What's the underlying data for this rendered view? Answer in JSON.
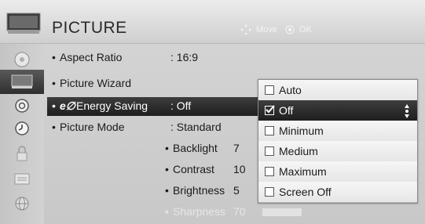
{
  "header": {
    "title": "PICTURE",
    "hints": [
      {
        "icon": "move-arrows-icon",
        "label": "Move"
      },
      {
        "icon": "ok-circle-icon",
        "label": "OK"
      }
    ]
  },
  "sidebar": {
    "items": [
      {
        "icon": "disc-icon",
        "active": false
      },
      {
        "icon": "tv-picture-icon",
        "active": true
      },
      {
        "icon": "speaker-icon",
        "active": false
      },
      {
        "icon": "clock-icon",
        "active": false
      },
      {
        "icon": "lock-icon",
        "active": false
      },
      {
        "icon": "option-box-icon",
        "active": false
      },
      {
        "icon": "network-globe-icon",
        "active": false
      }
    ]
  },
  "menu": {
    "rows": [
      {
        "label": "Aspect Ratio",
        "value": ": 16:9"
      },
      {
        "label": "Picture Wizard",
        "value": ""
      },
      {
        "mark": "e∅",
        "label": "Energy Saving",
        "value": ": Off"
      },
      {
        "label": "Picture Mode",
        "value": ": Standard"
      }
    ],
    "sub": [
      {
        "label": "Backlight",
        "value": "7"
      },
      {
        "label": "Contrast",
        "value": "10"
      },
      {
        "label": "Brightness",
        "value": "5"
      },
      {
        "label": "Sharpness",
        "value": "70"
      }
    ]
  },
  "dropdown": {
    "options": [
      {
        "label": "Auto",
        "checked": false
      },
      {
        "label": "Off",
        "checked": true
      },
      {
        "label": "Minimum",
        "checked": false
      },
      {
        "label": "Medium",
        "checked": false
      },
      {
        "label": "Maximum",
        "checked": false
      },
      {
        "label": "Screen Off",
        "checked": false
      }
    ]
  }
}
